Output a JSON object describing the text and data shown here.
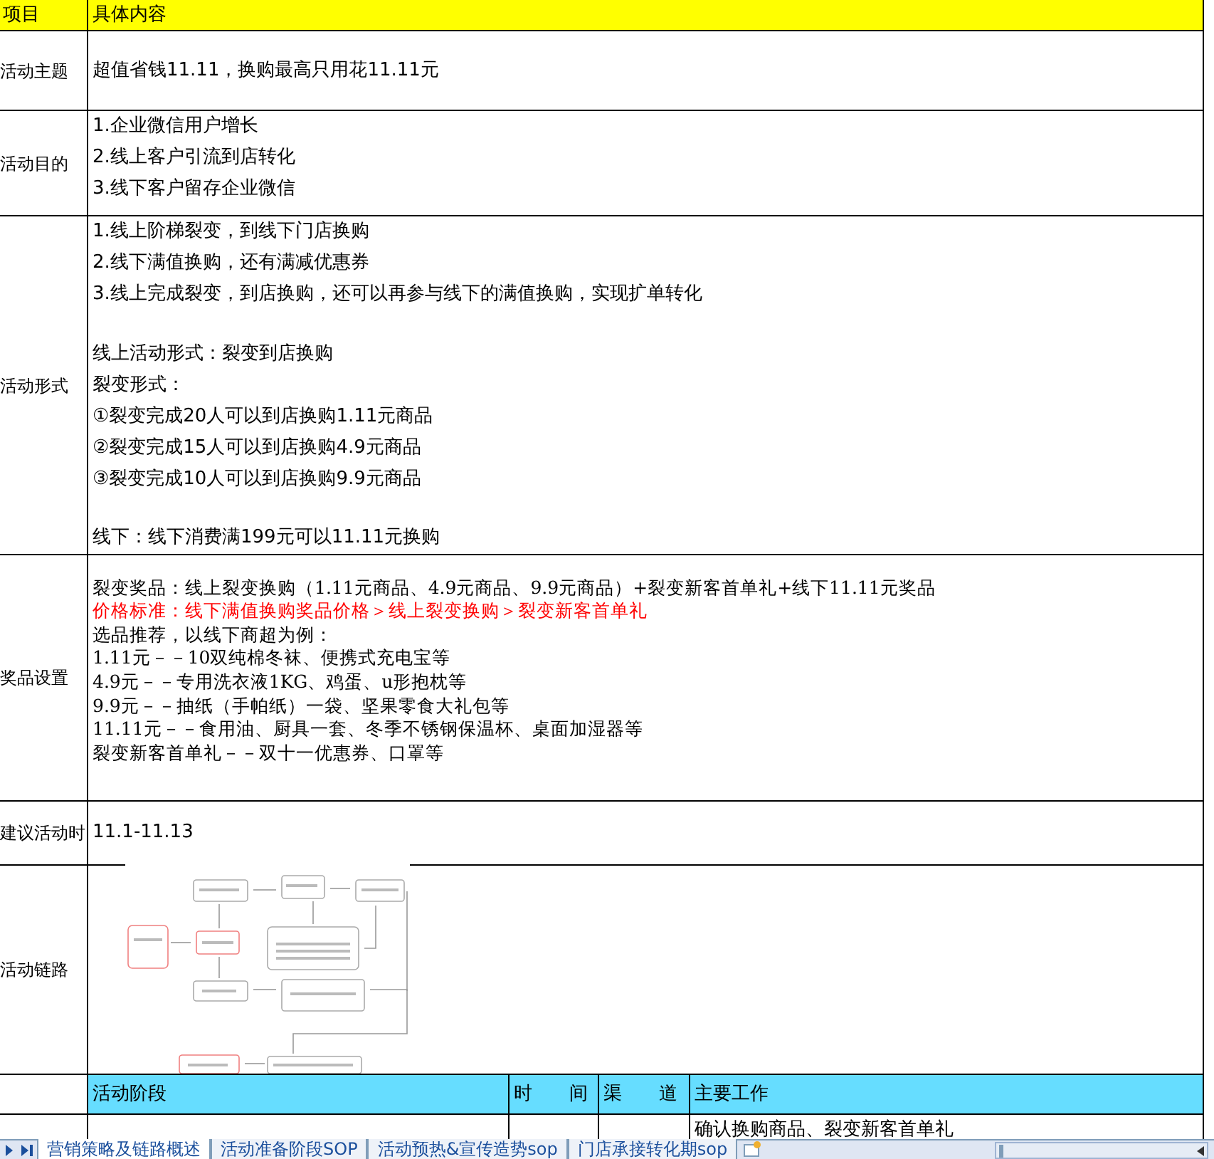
{
  "header": {
    "column_a": "项目",
    "column_b": "具体内容"
  },
  "rows": [
    {
      "kind": "text",
      "label": "活动主题",
      "paragraphs": [
        [
          {
            "text": "超值省钱11.11，换购最高只用花11.11元",
            "emphasis": false
          }
        ]
      ]
    },
    {
      "kind": "text",
      "label": "活动目的",
      "paragraphs": [
        [
          {
            "text": "1.企业微信用户增长",
            "emphasis": false
          },
          {
            "text": "2.线上客户引流到店转化",
            "emphasis": false
          },
          {
            "text": "3.线下客户留存企业微信",
            "emphasis": false
          }
        ]
      ]
    },
    {
      "kind": "text",
      "label": "活动形式",
      "paragraphs": [
        [
          {
            "text": "1.线上阶梯裂变，到线下门店换购",
            "emphasis": false
          },
          {
            "text": "2.线下满值换购，还有满减优惠券",
            "emphasis": false
          },
          {
            "text": "3.线上完成裂变，到店换购，还可以再参与线下的满值换购，实现扩单转化",
            "emphasis": false
          }
        ],
        [
          {
            "text": "线上活动形式：裂变到店换购",
            "emphasis": false
          },
          {
            "text": "裂变形式：",
            "emphasis": false
          },
          {
            "text": "①裂变完成20人可以到店换购1.11元商品",
            "emphasis": false
          },
          {
            "text": "②裂变完成15人可以到店换购4.9元商品",
            "emphasis": false
          },
          {
            "text": "③裂变完成10人可以到店换购9.9元商品",
            "emphasis": false
          }
        ],
        [
          {
            "text": "线下：线下消费满199元可以11.11元换购",
            "emphasis": false
          }
        ]
      ]
    },
    {
      "kind": "compact",
      "label": "奖品设置",
      "paragraphs": [
        [
          {
            "text": "裂变奖品：线上裂变换购（1.11元商品、4.9元商品、9.9元商品）+裂变新客首单礼+线下11.11元奖品",
            "emphasis": false
          },
          {
            "text": "价格标准：线下满值换购奖品价格＞线上裂变换购＞裂变新客首单礼",
            "emphasis": true
          },
          {
            "text": "选品推荐，以线下商超为例：",
            "emphasis": false
          },
          {
            "text": "1.11元－－10双纯棉冬袜、便携式充电宝等",
            "emphasis": false
          },
          {
            "text": "4.9元－－专用洗衣液1KG、鸡蛋、u形抱枕等",
            "emphasis": false
          },
          {
            "text": "9.9元－－抽纸（手帕纸）一袋、坚果零食大礼包等",
            "emphasis": false
          },
          {
            "text": "11.11元－－食用油、厨具一套、冬季不锈钢保温杯、桌面加湿器等",
            "emphasis": false
          },
          {
            "text": "裂变新客首单礼－－双十一优惠券、口罩等",
            "emphasis": false
          }
        ]
      ]
    },
    {
      "kind": "text",
      "label": "建议活动时",
      "paragraphs": [
        [
          {
            "text": "11.1-11.13",
            "emphasis": false
          }
        ]
      ]
    },
    {
      "kind": "diagram",
      "label": "活动链路"
    }
  ],
  "stage_table": {
    "columns": [
      "活动阶段",
      "时　　间",
      "渠　　道",
      "主要工作"
    ],
    "first_row": {
      "column_4": "确认换购商品、裂变新客首单礼"
    }
  },
  "sheet_tabs": [
    {
      "label": "营销策略及链路概述",
      "selected": true
    },
    {
      "label": "活动准备阶段SOP",
      "selected": false
    },
    {
      "label": "活动预热&宣传造势sop",
      "selected": false
    },
    {
      "label": "门店承接转化期sop",
      "selected": false
    }
  ]
}
